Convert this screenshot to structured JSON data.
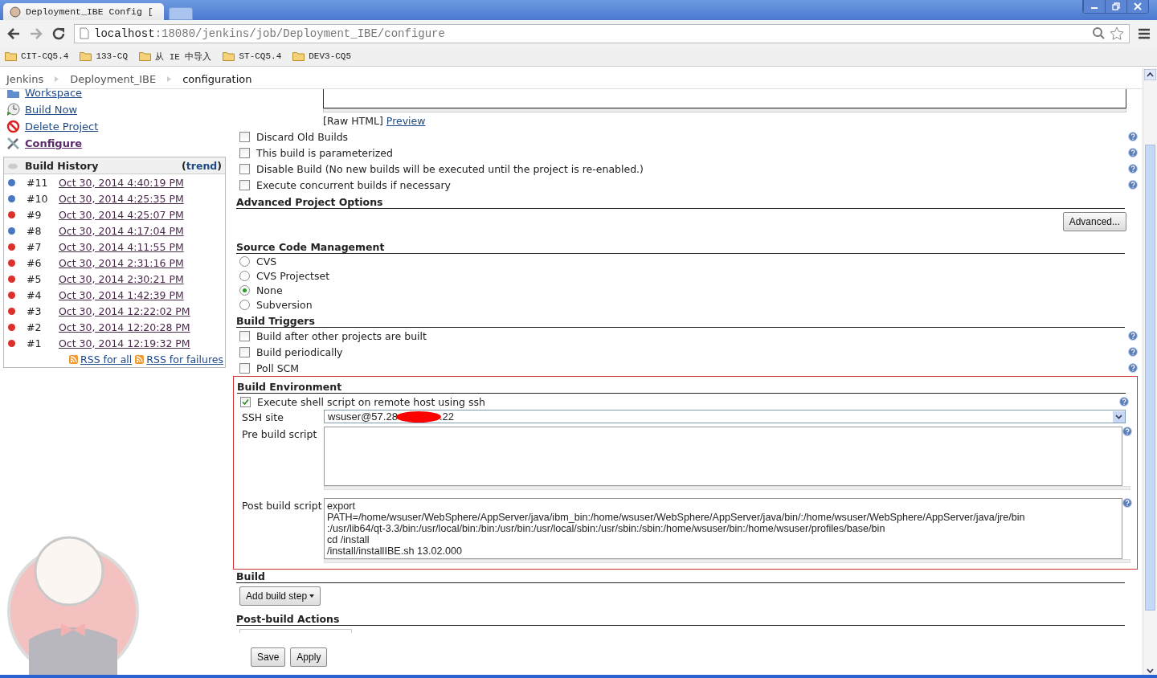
{
  "browser": {
    "tab_title": "Deployment_IBE Config [",
    "url_host": "localhost",
    "url_path": ":18080/jenkins/job/Deployment_IBE/configure",
    "bookmarks": [
      "CIT-CQ5.4",
      "133-CQ",
      "从 IE 中导入",
      "ST-CQ5.4",
      "DEV3-CQ5"
    ]
  },
  "breadcrumbs": [
    "Jenkins",
    "Deployment_IBE",
    "configuration"
  ],
  "sidebar": {
    "links": [
      {
        "label": "Workspace",
        "kind": "folder",
        "selected": false
      },
      {
        "label": "Build Now",
        "kind": "build",
        "selected": false
      },
      {
        "label": "Delete Project",
        "kind": "delete",
        "selected": false
      },
      {
        "label": "Configure",
        "kind": "configure",
        "selected": true
      }
    ]
  },
  "build_history": {
    "title": "Build History",
    "trend_prefix": "(",
    "trend": "trend",
    "trend_suffix": ")",
    "builds": [
      {
        "number": "#11",
        "date": "Oct 30, 2014 4:40:19 PM",
        "color": "#4a78c0"
      },
      {
        "number": "#10",
        "date": "Oct 30, 2014 4:25:35 PM",
        "color": "#4a78c0"
      },
      {
        "number": "#9",
        "date": "Oct 30, 2014 4:25:07 PM",
        "color": "#d9302c"
      },
      {
        "number": "#8",
        "date": "Oct 30, 2014 4:17:04 PM",
        "color": "#4a78c0"
      },
      {
        "number": "#7",
        "date": "Oct 30, 2014 4:11:55 PM",
        "color": "#d9302c"
      },
      {
        "number": "#6",
        "date": "Oct 30, 2014 2:31:16 PM",
        "color": "#d9302c"
      },
      {
        "number": "#5",
        "date": "Oct 30, 2014 2:30:21 PM",
        "color": "#d9302c"
      },
      {
        "number": "#4",
        "date": "Oct 30, 2014 1:42:39 PM",
        "color": "#d9302c"
      },
      {
        "number": "#3",
        "date": "Oct 30, 2014 12:22:02 PM",
        "color": "#d9302c"
      },
      {
        "number": "#2",
        "date": "Oct 30, 2014 12:20:28 PM",
        "color": "#d9302c"
      },
      {
        "number": "#1",
        "date": "Oct 30, 2014 12:19:32 PM",
        "color": "#d9302c"
      }
    ],
    "rss_all": "RSS for all",
    "rss_failures": "RSS for failures"
  },
  "description": {
    "raw_html": "[Raw HTML]",
    "preview": "Preview"
  },
  "general_options": [
    {
      "label": "Discard Old Builds",
      "checked": false
    },
    {
      "label": "This build is parameterized",
      "checked": false
    },
    {
      "label": "Disable Build (No new builds will be executed until the project is re-enabled.)",
      "checked": false
    },
    {
      "label": "Execute concurrent builds if necessary",
      "checked": false
    }
  ],
  "advanced_options": {
    "title": "Advanced Project Options",
    "button": "Advanced..."
  },
  "scm": {
    "title": "Source Code Management",
    "options": [
      {
        "label": "CVS",
        "selected": false
      },
      {
        "label": "CVS Projectset",
        "selected": false
      },
      {
        "label": "None",
        "selected": true
      },
      {
        "label": "Subversion",
        "selected": false
      }
    ]
  },
  "build_triggers": {
    "title": "Build Triggers",
    "options": [
      {
        "label": "Build after other projects are built",
        "checked": false
      },
      {
        "label": "Build periodically",
        "checked": false
      },
      {
        "label": "Poll SCM",
        "checked": false
      }
    ]
  },
  "build_environment": {
    "title": "Build Environment",
    "options": [
      {
        "label": "Execute shell script on remote host using ssh",
        "checked": true
      }
    ],
    "ssh_site": {
      "label": "SSH site",
      "value_start": "wsuser@57.28",
      "value_end": ".22"
    },
    "pre_build_script": {
      "label": "Pre build script"
    },
    "post_build_script": {
      "label": "Post build script",
      "lines": [
        "export",
        "PATH=/home/wsuser/WebSphere/AppServer/java/ibm_bin:/home/wsuser/WebSphere/AppServer/java/bin/:/home/wsuser/WebSphere/AppServer/java/jre/bin",
        ":/usr/lib64/qt-3.3/bin:/usr/local/bin:/bin:/usr/bin:/usr/local/sbin:/usr/sbin:/sbin:/home/wsuser/bin:/home/wsuser/profiles/base/bin",
        "cd /install",
        "/install/installIBE.sh 13.02.000"
      ]
    }
  },
  "build": {
    "title": "Build",
    "button": "Add build step"
  },
  "post_build_actions": {
    "title": "Post-build Actions"
  },
  "buttons": [
    "Save",
    "Apply"
  ]
}
